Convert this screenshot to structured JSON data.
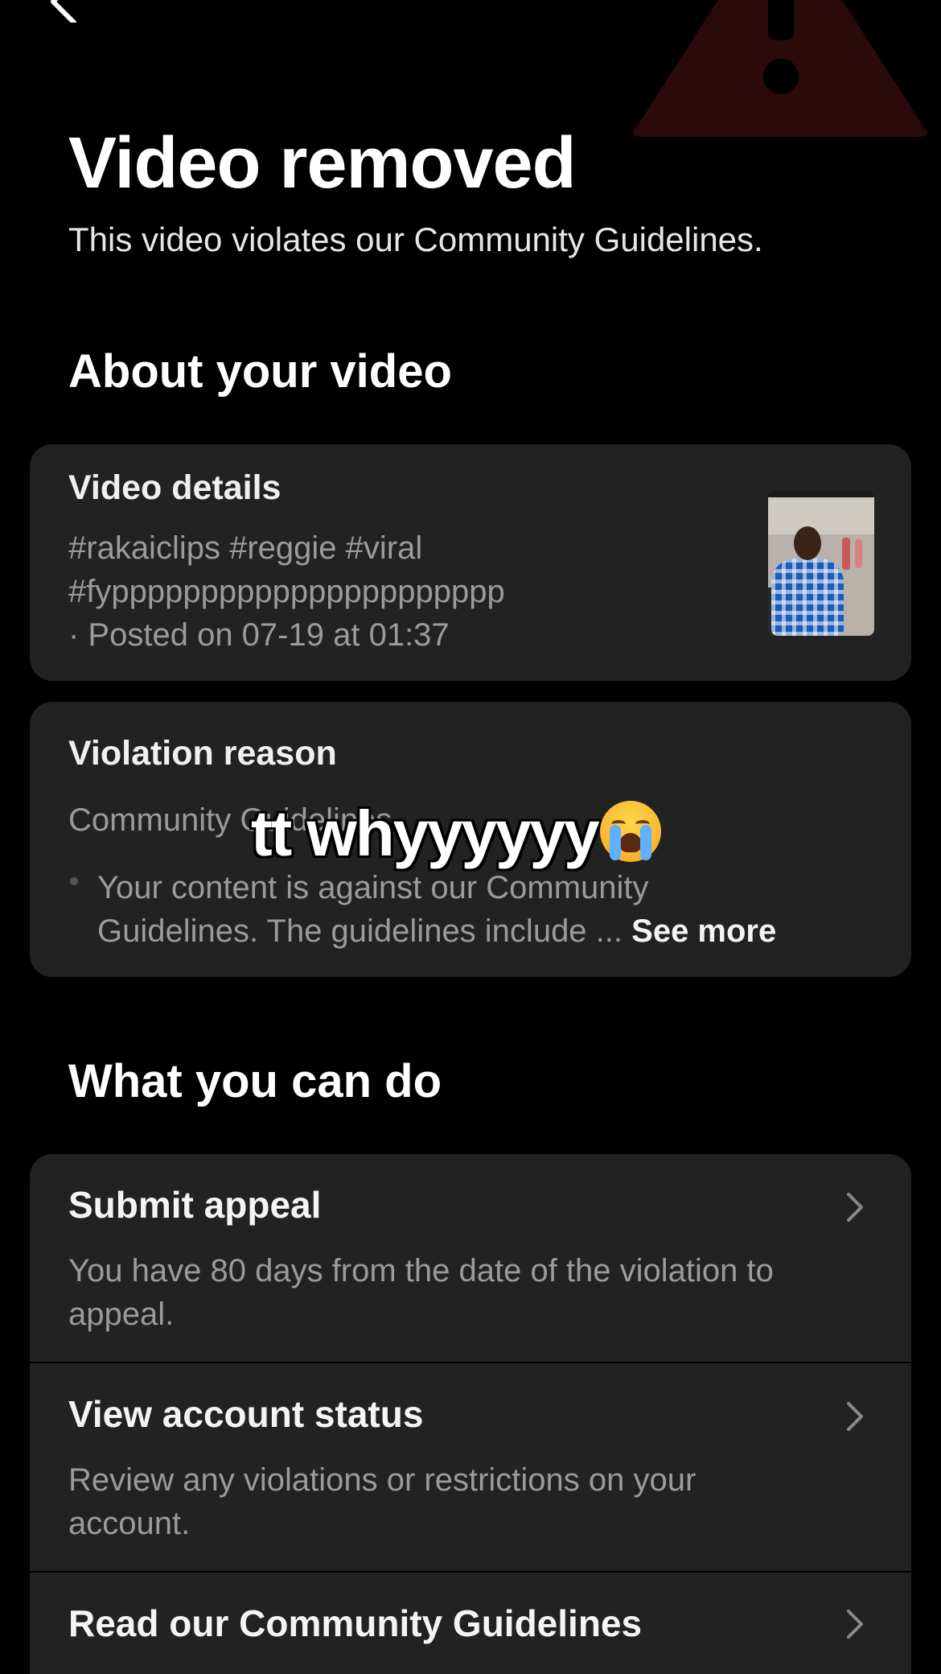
{
  "header": {
    "title": "Video removed",
    "subtitle": "This video violates our Community Guidelines."
  },
  "about": {
    "section_title": "About your video",
    "video_details": {
      "title": "Video details",
      "hashtags_line1": "#rakaiclips #reggie #viral",
      "hashtags_line2": "#fypppppppppppppppppppppp",
      "posted": "· Posted on 07-19 at 01:37"
    },
    "violation": {
      "title": "Violation reason",
      "category": "Community Guidelines",
      "bullet_line1": "Your content is against our Community",
      "bullet_line2": "Guidelines. The guidelines include ...",
      "see_more": "See more"
    }
  },
  "overlay": {
    "caption": "tt whyyyyyy"
  },
  "actions": {
    "section_title": "What you can do",
    "items": [
      {
        "title": "Submit appeal",
        "description": "You have 80 days from the date of the violation to appeal."
      },
      {
        "title": "View account status",
        "description": "Review any violations or restrictions on your account."
      },
      {
        "title": "Read our Community Guidelines",
        "description": ""
      }
    ]
  },
  "colors": {
    "background": "#000000",
    "card": "#222222",
    "muted_text": "#9b9b9b",
    "warning_icon": "#2a0c0c"
  }
}
